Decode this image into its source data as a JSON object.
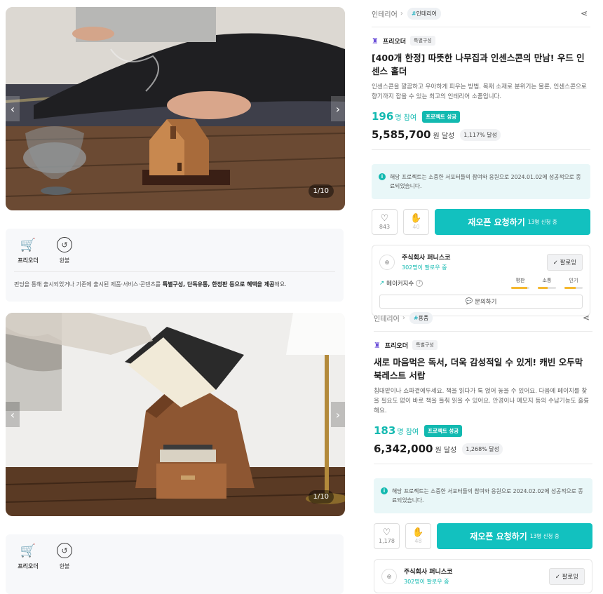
{
  "project1": {
    "image_counter": "1/10",
    "benefits": [
      {
        "icon": "shopping-cart-icon",
        "label": "프리오더"
      },
      {
        "icon": "refund-icon",
        "label": "환불"
      }
    ],
    "benefit_desc_prefix": "펀딩을 통해 출시되었거나 기존에 출시된 제품·서비스·콘텐츠를 ",
    "benefit_desc_bold": "특별구성, 단독유통, 한정판 등으로 혜택을 제공",
    "benefit_desc_suffix": "해요.",
    "category": "인테리어",
    "tag": "인테리어",
    "maker_type": "프리오더",
    "maker_tag": "특별구성",
    "title": "[400개 한정] 따뜻한 나무집과 인센스콘의 만남! 우드 인센스 홀더",
    "summary": "인센스콘을 깔끔하고 우아하게 피우는 방법. 목재 소재로 분위기는 물론, 인센스콘으로 향기까지 잡을 수 있는 최고의 인테리어 소품입니다.",
    "participants": "196",
    "participants_unit": "명 참여",
    "success_label": "프로젝트 성공",
    "amount": "5,585,700",
    "amount_unit": "원 달성",
    "percent": "1,117% 달성",
    "notice": "해당 프로젝트는 소중한 서포터들의 참여와 응원으로 2024.01.02에 성공적으로 종료되었습니다.",
    "likes": "843",
    "cheers": "40",
    "reopen_label": "재오픈 요청하기",
    "reopen_count": "13명 신청 중",
    "maker_name": "주식회사 퍼니스코",
    "maker_followers": "302명이 팔로우 중",
    "follow_label": "팔로잉",
    "index_label": "메이커지수",
    "meters": [
      {
        "label": "평판",
        "level": 0.9
      },
      {
        "label": "소통",
        "level": 0.55
      },
      {
        "label": "인기",
        "level": 0.6
      }
    ],
    "ask_label": "문의하기"
  },
  "project2": {
    "image_counter": "1/10",
    "benefits": [
      {
        "icon": "shopping-cart-icon",
        "label": "프리오더"
      },
      {
        "icon": "refund-icon",
        "label": "환불"
      }
    ],
    "category": "인테리어",
    "tag": "용품",
    "maker_type": "프리오더",
    "maker_tag": "특별구성",
    "title": "새로 마음먹은 독서, 더욱 감성적일 수 있게! 캐빈 오두막 북레스트 서랍",
    "summary": "침대맡이나 쇼파곁에두세요. 책을 읽다가 툭 얹어 놓을 수 있어요. 다음에 페이지를 찾을 필요도 없이 바로 책을 들춰 읽을 수 있어요. 안경이나 메모지 등의 수납기능도 훌륭해요.",
    "participants": "183",
    "participants_unit": "명 참여",
    "success_label": "프로젝트 성공",
    "amount": "6,342,000",
    "amount_unit": "원 달성",
    "percent": "1,268% 달성",
    "notice": "해당 프로젝트는 소중한 서포터들의 참여와 응원으로 2024.02.02에 성공적으로 종료되었습니다.",
    "likes": "1,178",
    "cheers": "48",
    "reopen_label": "재오픈 요청하기",
    "reopen_count": "13명 신청 중",
    "maker_name": "주식회사 퍼니스코",
    "maker_followers": "302명이 팔로우 중",
    "follow_label": "팔로잉"
  },
  "colors": {
    "accent": "#12B9B0",
    "button": "#12C1BF",
    "notice_bg": "#E9F7F8",
    "meter": "#F5B82E"
  }
}
